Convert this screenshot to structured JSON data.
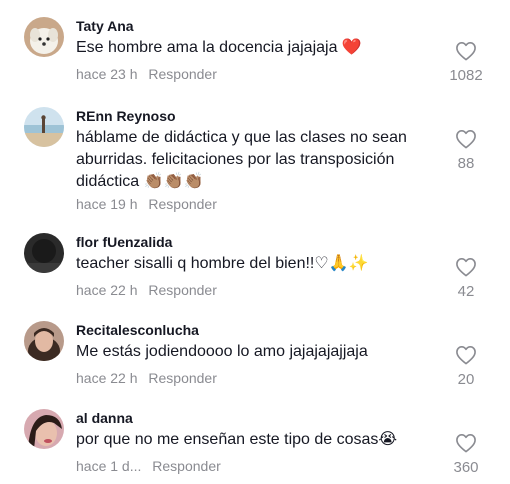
{
  "comments": [
    {
      "username": "Taty Ana",
      "text": "Ese hombre ama la docencia jajajaja ❤️",
      "time": "hace 23 h",
      "reply": "Responder",
      "likes": "1082",
      "avatar_icon": "white-dog-avatar"
    },
    {
      "username": "REnn Reynoso",
      "text": "háblame de didáctica y que las clases no sean aburridas. felicitaciones por las transposición didáctica 👏🏽👏🏽👏🏽",
      "time": "hace 19 h",
      "reply": "Responder",
      "likes": "88",
      "avatar_icon": "beach-avatar"
    },
    {
      "username": "flor fUenzalida",
      "text": "teacher sisalli q hombre del bien!!♡🙏✨",
      "time": "hace 22 h",
      "reply": "Responder",
      "likes": "42",
      "avatar_icon": "dark-photo-avatar"
    },
    {
      "username": "Recitalesconlucha",
      "text": "Me estás jodiendoooo lo amo jajajajajjaja",
      "time": "hace 22 h",
      "reply": "Responder",
      "likes": "20",
      "avatar_icon": "woman-avatar"
    },
    {
      "username": "al danna",
      "text": "por que no me enseñan este tipo de cosas😭",
      "time": "hace 1 d...",
      "reply": "Responder",
      "likes": "360",
      "avatar_icon": "woman-selfie-avatar"
    }
  ],
  "colors": {
    "primary_text": "#161823",
    "secondary_text": "#8a8b91",
    "background": "#ffffff"
  }
}
